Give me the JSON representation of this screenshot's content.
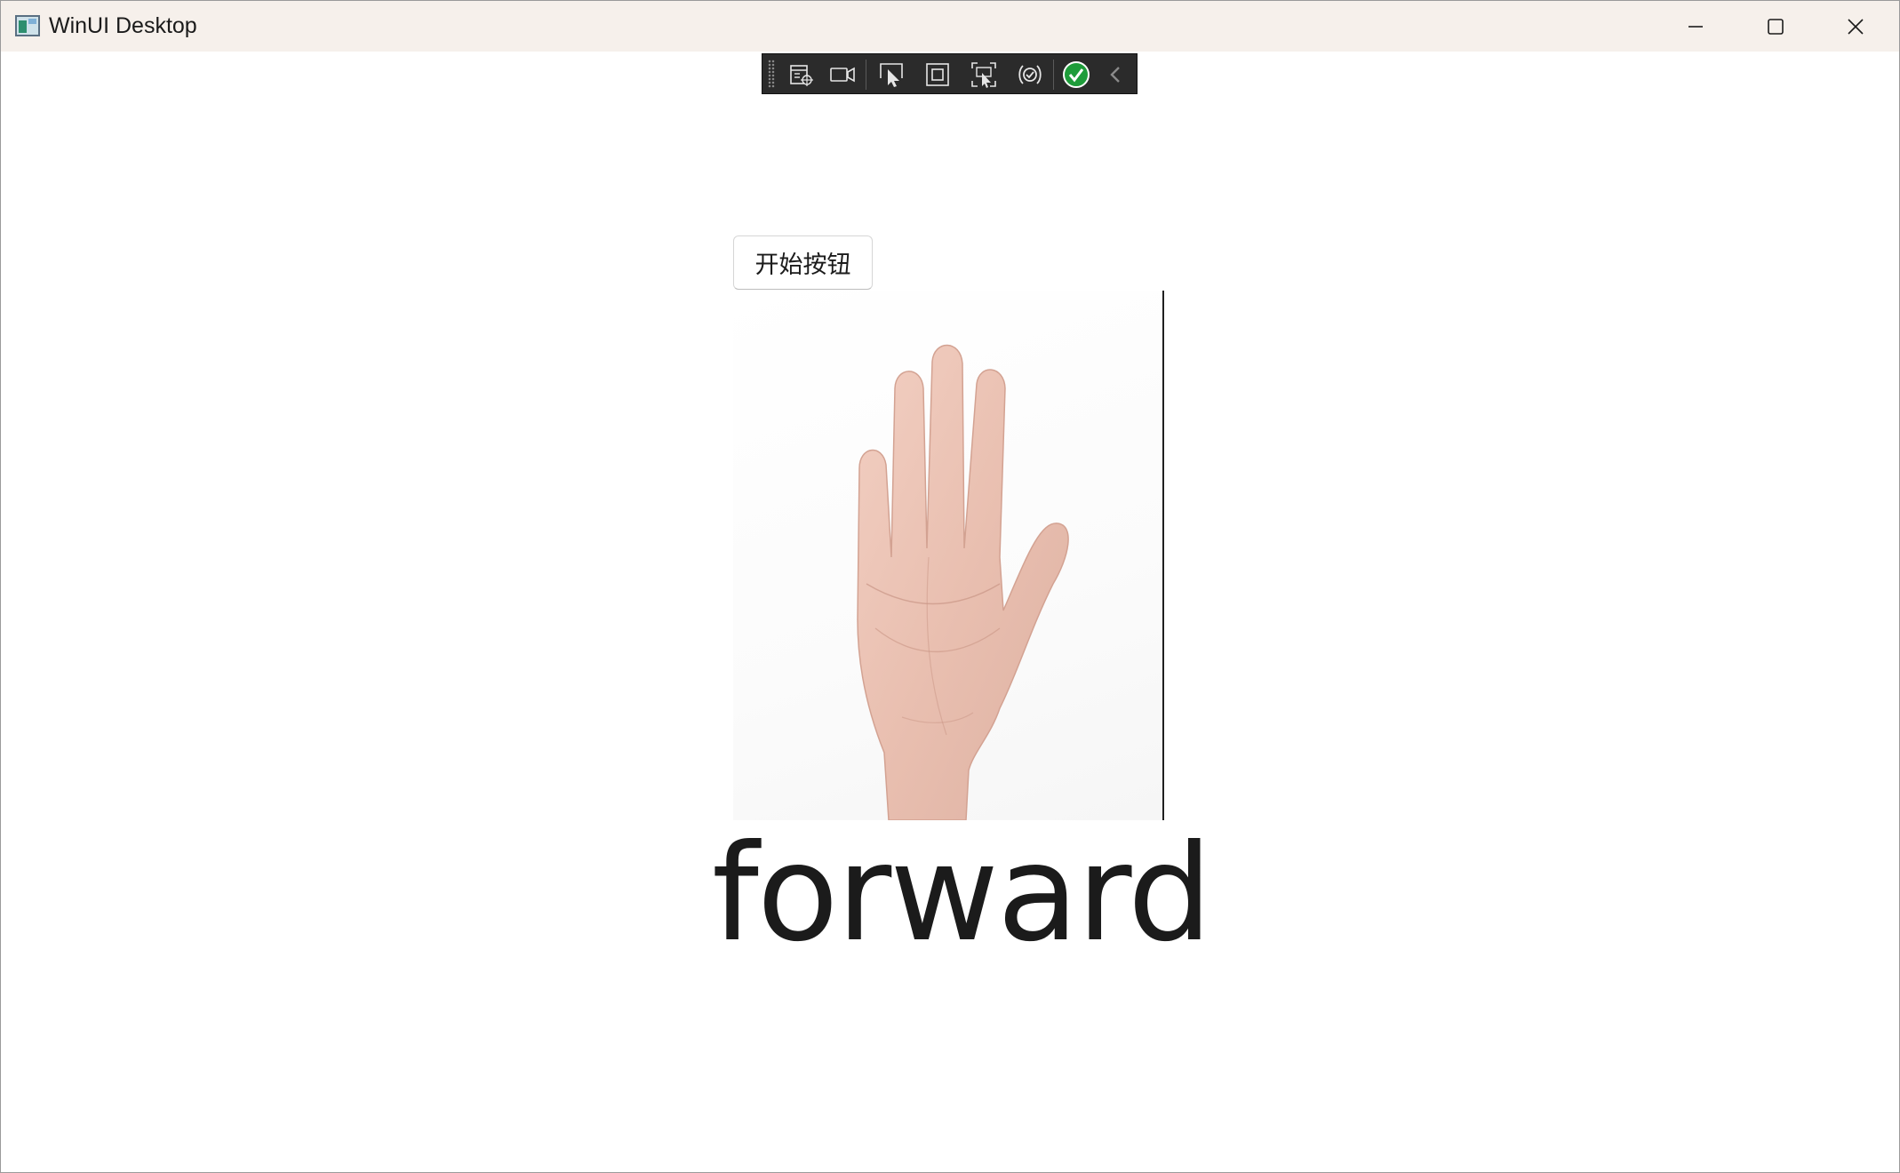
{
  "window": {
    "title": "WinUI Desktop",
    "controls": [
      "minimize-icon",
      "maximize-icon",
      "close-icon"
    ]
  },
  "debug_toolbar": {
    "tools": [
      "live-visual-tree-icon",
      "record-icon",
      "select-element-icon",
      "display-layout-adorners-icon",
      "track-focused-element-icon",
      "hot-reload-icon",
      "xaml-binding-ok-icon",
      "collapse-chevron-icon"
    ]
  },
  "main": {
    "start_button_label": "开始按钮",
    "gesture_image": "open-palm-hand",
    "gesture_label": "forward"
  },
  "colors": {
    "titlebar_bg": "#f6f0eb",
    "toolbar_bg": "#2b2b2b",
    "status_ok": "#1e9c3a",
    "text": "#1b1b1b"
  }
}
